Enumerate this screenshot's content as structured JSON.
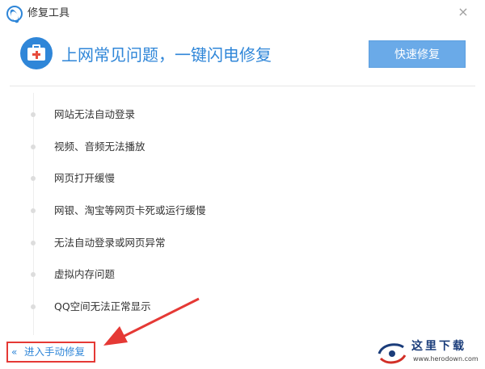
{
  "window": {
    "title": "修复工具",
    "close_label": "×"
  },
  "header": {
    "headline": "上网常见问题，一键闪电修复",
    "quick_fix_label": "快速修复"
  },
  "issues": [
    {
      "label": "网站无法自动登录"
    },
    {
      "label": "视频、音频无法播放"
    },
    {
      "label": "网页打开缓慢"
    },
    {
      "label": "网银、淘宝等网页卡死或运行缓慢"
    },
    {
      "label": "无法自动登录或网页异常"
    },
    {
      "label": "虚拟内存问题"
    },
    {
      "label": "QQ空间无法正常显示"
    }
  ],
  "footer": {
    "manual_chevron": "«",
    "manual_label": "进入手动修复"
  },
  "watermark": {
    "text": "这里下载",
    "url": "www.herodown.com"
  },
  "colors": {
    "accent": "#2f86d8",
    "button": "#6aaae8",
    "highlight": "#e53935",
    "icon_cross": "#e74c3c"
  },
  "icons": {
    "app": "browser-logo-icon",
    "header": "first-aid-kit-icon",
    "close": "close-icon",
    "manual": "double-chevron-left-icon"
  }
}
